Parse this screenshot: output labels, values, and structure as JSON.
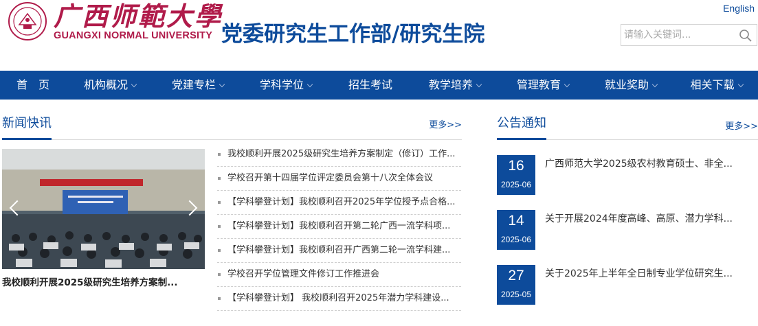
{
  "header": {
    "logo_cn": "广西师範大學",
    "logo_en": "GUANGXI NORMAL UNIVERSITY",
    "site_title": "党委研究生工作部/研究生院",
    "lang_link": "English",
    "search_placeholder": "请输入关键词..."
  },
  "nav": {
    "items": [
      {
        "label": "首　页"
      },
      {
        "label": "机构概况"
      },
      {
        "label": "党建专栏"
      },
      {
        "label": "学科学位"
      },
      {
        "label": "招生考试"
      },
      {
        "label": "教学培养"
      },
      {
        "label": "管理教育"
      },
      {
        "label": "就业奖助"
      },
      {
        "label": "相关下载"
      }
    ]
  },
  "news": {
    "title": "新闻快讯",
    "more": "更多>>",
    "slide_caption": "我校顺利开展2025级研究生培养方案制...",
    "items": [
      "我校顺利开展2025级研究生培养方案制定（修订）工作...",
      "学校召开第十四届学位评定委员会第十八次全体会议",
      "【学科攀登计划】我校顺利召开2025年学位授予点合格...",
      "【学科攀登计划】我校顺利召开第二轮广西一流学科项...",
      "【学科攀登计划】我校顺利召开广西第二轮一流学科建...",
      "学校召开学位管理文件修订工作推进会",
      "【学科攀登计划】 我校顺利召开2025年潜力学科建设..."
    ]
  },
  "notices": {
    "title": "公告通知",
    "more": "更多>>",
    "items": [
      {
        "day": "16",
        "ym": "2025-06",
        "text": "广西师范大学2025级农村教育硕士、非全..."
      },
      {
        "day": "14",
        "ym": "2025-06",
        "text": "关于开展2024年度高峰、高原、潜力学科..."
      },
      {
        "day": "27",
        "ym": "2025-05",
        "text": "关于2025年上半年全日制专业学位研究生..."
      }
    ]
  },
  "colors": {
    "primary": "#0d4b9b",
    "logo": "#b01b4a"
  }
}
